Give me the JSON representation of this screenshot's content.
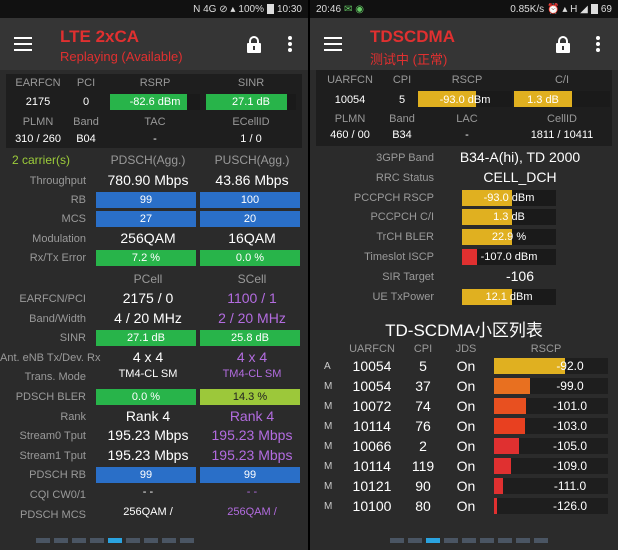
{
  "left": {
    "status": {
      "icons": "N  4G  ⊘  ▴",
      "battery": "100%",
      "time": "10:30"
    },
    "title": "LTE 2xCA",
    "subtitle": "Replaying (Available)",
    "top_grid": {
      "headers1": [
        "EARFCN",
        "PCI",
        "RSRP",
        "SINR"
      ],
      "values1": [
        "2175",
        "0",
        "-82.6 dBm",
        "27.1 dB"
      ],
      "headers2": [
        "PLMN",
        "Band",
        "TAC",
        "ECellID"
      ],
      "values2": [
        "310 / 260",
        "B04",
        "-",
        "1 / 0"
      ]
    },
    "carriers_label": "2 carrier(s)",
    "pdsch_agg": "PDSCH(Agg.)",
    "pusch_agg": "PUSCH(Agg.)",
    "rows_agg": [
      {
        "label": "Throughput",
        "dl": "780.90 Mbps",
        "ul": "43.86 Mbps"
      },
      {
        "label": "RB",
        "dl": "99",
        "ul": "100"
      },
      {
        "label": "MCS",
        "dl": "27",
        "ul": "20"
      },
      {
        "label": "Modulation",
        "dl": "256QAM",
        "ul": "16QAM"
      },
      {
        "label": "Rx/Tx Error",
        "dl": "7.2 %",
        "ul": "0.0 %"
      }
    ],
    "pcell": "PCell",
    "scell": "SCell",
    "rows_cell": [
      {
        "label": "EARFCN/PCI",
        "p": "2175 / 0",
        "s": "1100 / 1"
      },
      {
        "label": "Band/Width",
        "p": "4 / 20 MHz",
        "s": "2 / 20 MHz"
      },
      {
        "label": "SINR",
        "p": "27.1 dB",
        "s": "25.8 dB"
      },
      {
        "label": "Ant. eNB Tx/Dev. Rx",
        "p": "4 x 4",
        "s": "4 x 4"
      },
      {
        "label": "Trans. Mode",
        "p": "TM4-CL SM",
        "s": "TM4-CL SM"
      },
      {
        "label": "PDSCH BLER",
        "p": "0.0 %",
        "s": "14.3 %"
      },
      {
        "label": "Rank",
        "p": "Rank 4",
        "s": "Rank 4"
      },
      {
        "label": "Stream0 Tput",
        "p": "195.23 Mbps",
        "s": "195.23 Mbps"
      },
      {
        "label": "Stream1 Tput",
        "p": "195.23 Mbps",
        "s": "195.23 Mbps"
      },
      {
        "label": "PDSCH RB",
        "p": "99",
        "s": "99"
      },
      {
        "label": "CQI CW0/1",
        "p": "-   -",
        "s": "-   -"
      },
      {
        "label": "PDSCH MCS",
        "p": "256QAM /",
        "s": "256QAM /"
      }
    ],
    "bar_levels": {
      "rsrp": 0.85,
      "sinr": 0.9
    }
  },
  "right": {
    "status": {
      "time": "20:46",
      "icons": "✉ ◉",
      "speed": "0.85K/s",
      "net": "⏰ ▴ H ◢",
      "battery": "69"
    },
    "title": "TDSCDMA",
    "subtitle": "测试中 (正常)",
    "top_grid": {
      "headers1": [
        "UARFCN",
        "CPI",
        "RSCP",
        "C/I"
      ],
      "values1": [
        "10054",
        "5",
        "-93.0 dBm",
        "1.3 dB"
      ],
      "headers2": [
        "PLMN",
        "Band",
        "LAC",
        "CellID"
      ],
      "values2": [
        "460 / 00",
        "B34",
        "-",
        "1811 / 10411"
      ]
    },
    "info": [
      {
        "label": "3GPP Band",
        "value": "B34-A(hi), TD 2000"
      },
      {
        "label": "RRC Status",
        "value": "CELL_DCH"
      },
      {
        "label": "PCCPCH RSCP",
        "value": "-93.0 dBm",
        "color": "#e0b020",
        "level": 0.53
      },
      {
        "label": "PCCPCH C/I",
        "value": "1.3 dB",
        "color": "#e0b020",
        "level": 0.53
      },
      {
        "label": "TrCH BLER",
        "value": "22.9 %",
        "color": "#e0b020",
        "level": 0.53
      },
      {
        "label": "Timeslot ISCP",
        "value": "-107.0 dBm",
        "color": "#e03030",
        "level": 0.16
      },
      {
        "label": "SIR Target",
        "value": "-106"
      },
      {
        "label": "UE TxPower",
        "value": "12.1 dBm",
        "color": "#e0b020",
        "level": 0.53
      }
    ],
    "list_title": "TD-SCDMA小区列表",
    "list_headers": [
      "UARFCN",
      "CPI",
      "JDS",
      "RSCP"
    ],
    "list": [
      {
        "type": "A",
        "uarfcn": "10054",
        "cpi": "5",
        "jds": "On",
        "rscp": "-92.0",
        "level": 0.62,
        "color": "#e0b020"
      },
      {
        "type": "M",
        "uarfcn": "10054",
        "cpi": "37",
        "jds": "On",
        "rscp": "-99.0",
        "level": 0.32,
        "color": "#e87020"
      },
      {
        "type": "M",
        "uarfcn": "10072",
        "cpi": "74",
        "jds": "On",
        "rscp": "-101.0",
        "level": 0.28,
        "color": "#e85020"
      },
      {
        "type": "M",
        "uarfcn": "10114",
        "cpi": "76",
        "jds": "On",
        "rscp": "-103.0",
        "level": 0.27,
        "color": "#e84020"
      },
      {
        "type": "M",
        "uarfcn": "10066",
        "cpi": "2",
        "jds": "On",
        "rscp": "-105.0",
        "level": 0.22,
        "color": "#e03030"
      },
      {
        "type": "M",
        "uarfcn": "10114",
        "cpi": "119",
        "jds": "On",
        "rscp": "-109.0",
        "level": 0.15,
        "color": "#e03030"
      },
      {
        "type": "M",
        "uarfcn": "10121",
        "cpi": "90",
        "jds": "On",
        "rscp": "-111.0",
        "level": 0.08,
        "color": "#e03030"
      },
      {
        "type": "M",
        "uarfcn": "10100",
        "cpi": "80",
        "jds": "On",
        "rscp": "-126.0",
        "level": 0.03,
        "color": "#e03030"
      }
    ],
    "bar_levels": {
      "rscp": 0.62,
      "ci": 0.6
    }
  },
  "pages": {
    "left_count": 9,
    "left_active": 4,
    "right_count": 9,
    "right_active": 2
  },
  "colors": {
    "accent_red": "#e03030",
    "green": "#28b44a",
    "blue": "#2a6fc8",
    "yellow": "#e0b020",
    "purple": "#b36ce0"
  }
}
